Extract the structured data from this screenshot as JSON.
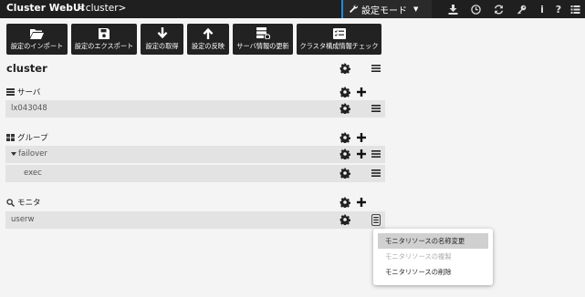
{
  "header": {
    "app_title": "Cluster WebUI",
    "cluster_tag": "<cluster>",
    "mode_label": "設定モード",
    "icons": [
      "download-icon",
      "clock-icon",
      "refresh-icon",
      "wrench-icon",
      "info-icon",
      "help-icon",
      "menu-list-icon"
    ]
  },
  "toolbar": {
    "import": "設定のインポート",
    "export": "設定のエクスポート",
    "fetch": "設定の取得",
    "apply": "設定の反映",
    "server_update": "サーバ情報の更新",
    "check": "クラスタ構成情報チェック"
  },
  "cluster": {
    "title": "cluster"
  },
  "servers": {
    "title": "サーバ",
    "items": [
      {
        "name": "lx043048"
      }
    ]
  },
  "groups": {
    "title": "グループ",
    "items": [
      {
        "name": "failover",
        "resources": [
          {
            "name": "exec"
          }
        ]
      }
    ]
  },
  "monitors": {
    "title": "モニタ",
    "items": [
      {
        "name": "userw"
      }
    ]
  },
  "context_menu": {
    "items": [
      {
        "label": "モニタリソースの名称変更",
        "state": "highlighted"
      },
      {
        "label": "モニタリソースの複製",
        "state": "disabled"
      },
      {
        "label": "モニタリソースの削除",
        "state": "normal"
      }
    ]
  },
  "colors": {
    "topbar": "#1f1f1f",
    "accent": "#1e88e5",
    "toolbar_button": "#222222",
    "row": "#e3e3e3",
    "background": "#f4f4f4"
  }
}
